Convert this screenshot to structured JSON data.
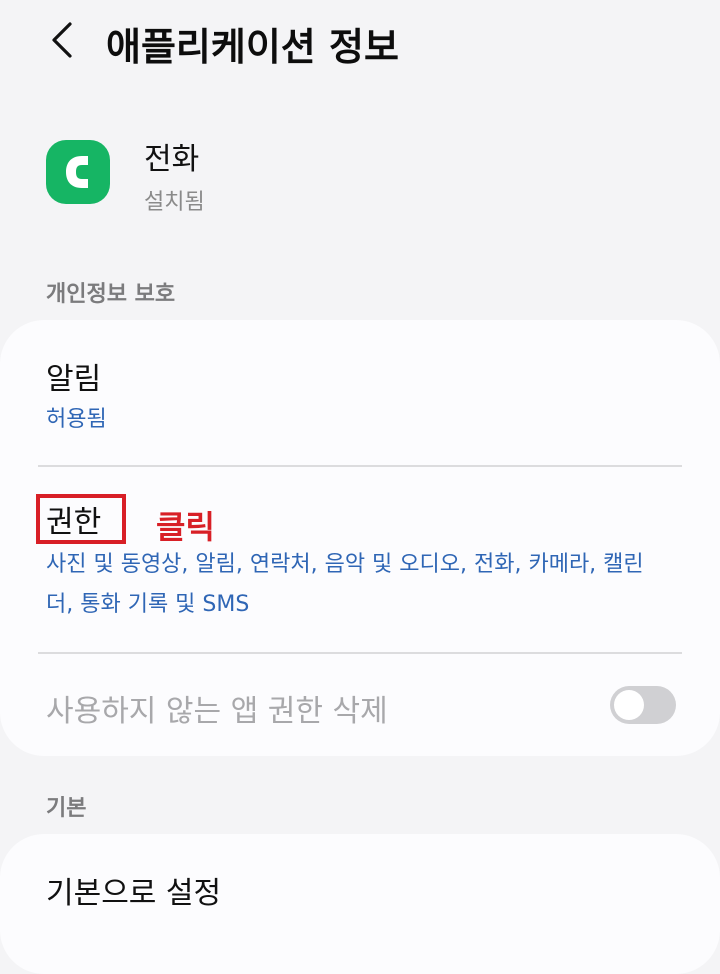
{
  "header": {
    "title": "애플리케이션 정보"
  },
  "app": {
    "name": "전화",
    "status": "설치됨",
    "icon": "phone-app-icon",
    "icon_color": "#16b564"
  },
  "privacy_section": {
    "label": "개인정보 보호",
    "items": [
      {
        "title": "알림",
        "subtitle": "허용됨"
      },
      {
        "title": "권한",
        "subtitle": "사진 및 동영상, 알림, 연락처, 음악 및 오디오, 전화, 카메라, 캘린더, 통화 기록 및 SMS"
      }
    ],
    "remove_unused_permissions": {
      "label": "사용하지 않는 앱 권한 삭제",
      "enabled": false
    }
  },
  "annotation": {
    "click_label": "클릭",
    "color": "#d81f26"
  },
  "default_section": {
    "label": "기본",
    "items": [
      {
        "title": "기본으로 설정"
      }
    ]
  },
  "colors": {
    "background": "#f4f4f6",
    "card": "#fcfcfe",
    "link_blue": "#2f66b5",
    "disabled_gray": "#a8a8ab"
  }
}
